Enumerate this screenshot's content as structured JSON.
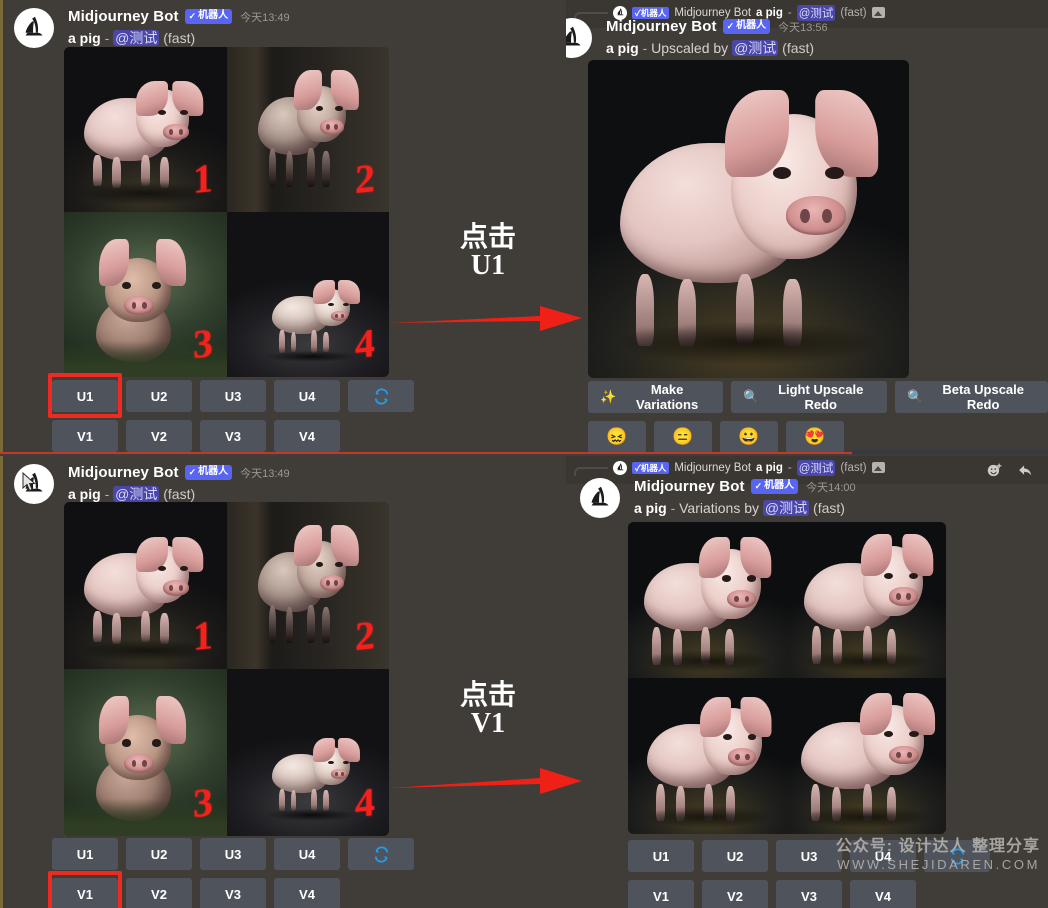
{
  "meta": {
    "app": "Discord",
    "colors": {
      "background": "#413d38",
      "panel": "#403c37",
      "button": "#4f545c",
      "accent_blue": "#5865f2",
      "highlight_red": "#ef2a22",
      "divider_red": "#c0392b",
      "mention_bg": "#4a47a8",
      "text_primary": "#ffffff",
      "text_muted": "#9b9791"
    }
  },
  "panels": {
    "top_left": {
      "name": "grid-result-upscale-step",
      "message": {
        "author": "Midjourney Bot",
        "bot_tag": "机器人",
        "bot_tag_check": "✓",
        "timestamp": "今天13:49",
        "prompt": "a pig",
        "dash": "-",
        "mention": "@测试",
        "speed": "(fast)"
      },
      "grid": {
        "labels": [
          "1",
          "2",
          "3",
          "4"
        ]
      },
      "buttons": {
        "row1": [
          "U1",
          "U2",
          "U3",
          "U4"
        ],
        "refresh_icon": "refresh-icon",
        "row2": [
          "V1",
          "V2",
          "V3",
          "V4"
        ]
      },
      "highlighted_button": "U1"
    },
    "top_right": {
      "name": "upscaled-result",
      "reply_ref": {
        "bot_tag": "机器人",
        "bot_tag_check": "✓",
        "author": "Midjourney Bot",
        "prompt": "a pig",
        "dash": "-",
        "mention": "@测试",
        "speed": "(fast)",
        "attachment_icon": "image-icon"
      },
      "message": {
        "author": "Midjourney Bot",
        "bot_tag": "机器人",
        "bot_tag_check": "✓",
        "timestamp": "今天13:56",
        "prompt": "a pig",
        "dash": "-",
        "action": "Upscaled by",
        "mention": "@测试",
        "speed": "(fast)"
      },
      "buttons": {
        "actions": [
          {
            "label": "Make Variations",
            "icon": "sparkles-icon"
          },
          {
            "label": "Light Upscale Redo",
            "icon": "magnifier-icon"
          },
          {
            "label": "Beta Upscale Redo",
            "icon": "magnifier-icon"
          }
        ],
        "reactions": [
          "😖",
          "😑",
          "😀",
          "😍"
        ]
      }
    },
    "bottom_left": {
      "name": "grid-result-variation-step",
      "message": {
        "author": "Midjourney Bot",
        "bot_tag": "机器人",
        "bot_tag_check": "✓",
        "timestamp": "今天13:49",
        "prompt": "a pig",
        "dash": "-",
        "mention": "@测试",
        "speed": "(fast)"
      },
      "grid": {
        "labels": [
          "1",
          "2",
          "3",
          "4"
        ]
      },
      "buttons": {
        "row1": [
          "U1",
          "U2",
          "U3",
          "U4"
        ],
        "refresh_icon": "refresh-icon",
        "row2": [
          "V1",
          "V2",
          "V3",
          "V4"
        ]
      },
      "highlighted_button": "V1"
    },
    "bottom_right": {
      "name": "variations-result",
      "reply_ref": {
        "bot_tag": "机器人",
        "bot_tag_check": "✓",
        "author": "Midjourney Bot",
        "prompt": "a pig",
        "dash": "-",
        "mention": "@测试",
        "speed": "(fast)",
        "attachment_icon": "image-icon"
      },
      "message": {
        "author": "Midjourney Bot",
        "bot_tag": "机器人",
        "bot_tag_check": "✓",
        "timestamp": "今天14:00",
        "prompt": "a pig",
        "dash": "-",
        "action": "Variations by",
        "mention": "@测试",
        "speed": "(fast)"
      },
      "hover_actions": [
        "add-reaction-icon",
        "reply-icon"
      ],
      "buttons": {
        "row1": [
          "U1",
          "U2",
          "U3",
          "U4"
        ],
        "refresh_icon": "refresh-icon",
        "row2": [
          "V1",
          "V2",
          "V3",
          "V4"
        ]
      }
    }
  },
  "annotations": {
    "top": {
      "line1": "点击",
      "line2": "U1",
      "arrow": "right-arrow"
    },
    "bottom": {
      "line1": "点击",
      "line2": "V1",
      "arrow": "right-arrow"
    }
  },
  "watermark": {
    "line1": "公众号: 设计达人 整理分享",
    "line2": "WWW.SHEJIDAREN.COM"
  }
}
